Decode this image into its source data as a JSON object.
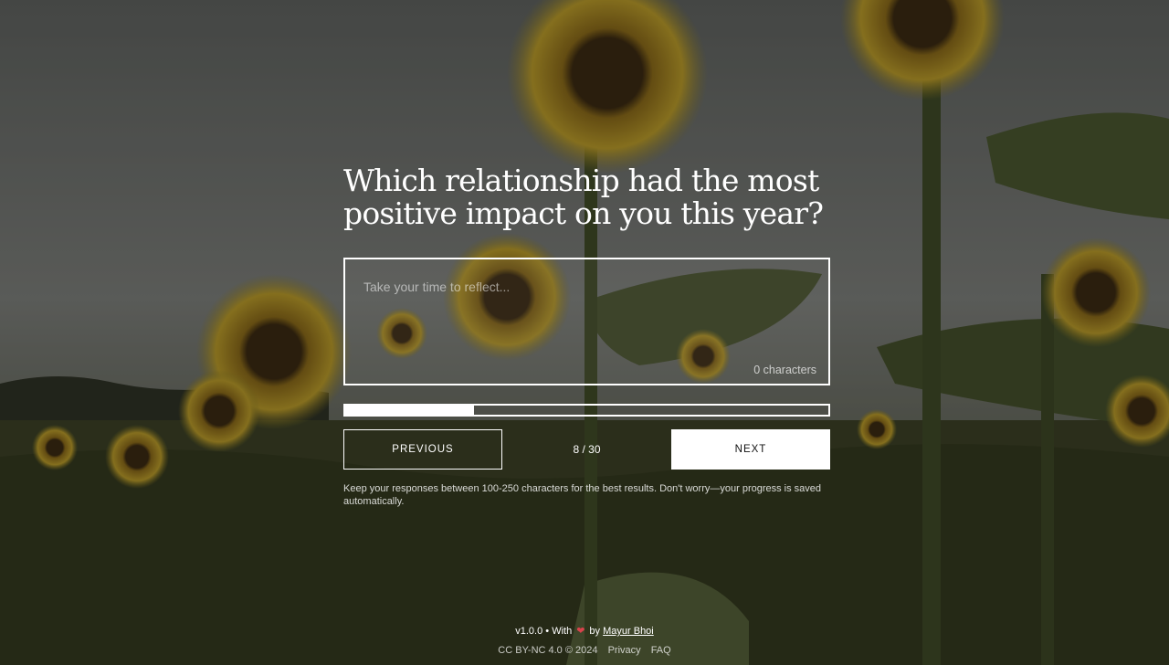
{
  "question": {
    "text": "Which relationship had the most positive impact on you this year?"
  },
  "answer": {
    "placeholder": "Take your time to reflect...",
    "value": "",
    "char_count": "0 characters"
  },
  "progress": {
    "current": 8,
    "total": 30,
    "fraction": 0.267,
    "label": "8 / 30"
  },
  "nav": {
    "previous_label": "PREVIOUS",
    "next_label": "NEXT"
  },
  "hint": "Keep your responses between 100-250 characters for the best results. Don't worry—your progress is saved automatically.",
  "footer": {
    "version": "v1.0.0",
    "with_text": "• With",
    "by_text": "by",
    "author": "Mayur Bhoi",
    "license": "CC BY-NC 4.0 © 2024",
    "privacy_label": "Privacy",
    "faq_label": "FAQ",
    "heart_color": "#d9434c"
  },
  "icons": {
    "heart": "heart-icon"
  }
}
